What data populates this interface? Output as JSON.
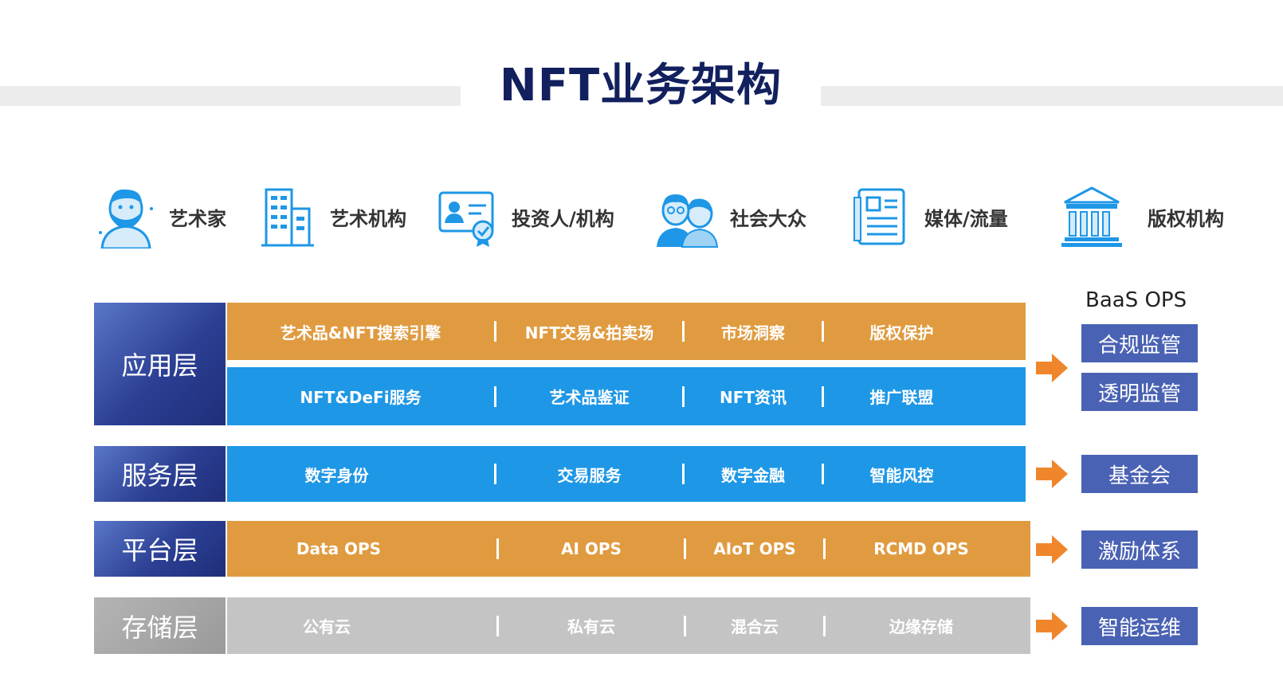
{
  "title": "NFT业务架构",
  "actors": [
    {
      "label": "艺术家",
      "icon": "artist-icon"
    },
    {
      "label": "艺术机构",
      "icon": "building-icon"
    },
    {
      "label": "投资人/机构",
      "icon": "id-card-icon"
    },
    {
      "label": "社会大众",
      "icon": "people-icon"
    },
    {
      "label": "媒体/流量",
      "icon": "news-icon"
    },
    {
      "label": "版权机构",
      "icon": "institution-icon"
    }
  ],
  "layers": {
    "app": {
      "label": "应用层",
      "row1": [
        "艺术品&NFT搜索引擎",
        "NFT交易&拍卖场",
        "市场洞察",
        "版权保护"
      ],
      "row2": [
        "NFT&DeFi服务",
        "艺术品鉴证",
        "NFT资讯",
        "推广联盟"
      ]
    },
    "service": {
      "label": "服务层",
      "items": [
        "数字身份",
        "交易服务",
        "数字金融",
        "智能风控"
      ]
    },
    "platform": {
      "label": "平台层",
      "items": [
        "Data OPS",
        "AI OPS",
        "AIoT OPS",
        "RCMD OPS"
      ]
    },
    "storage": {
      "label": "存储层",
      "items": [
        "公有云",
        "私有云",
        "混合云",
        "边缘存储"
      ]
    }
  },
  "ops": {
    "title": "BaaS OPS",
    "boxes": [
      "合规监管",
      "透明监管",
      "基金会",
      "激励体系",
      "智能运维"
    ]
  },
  "colors": {
    "title": "#12205e",
    "orange": "#e09b40",
    "blue": "#1e97e6",
    "gray": "#c4c4c4",
    "navy": "#2b3f93",
    "ops_box": "#4a62b4",
    "arrow": "#f0862c",
    "icon": "#1e97e6"
  }
}
